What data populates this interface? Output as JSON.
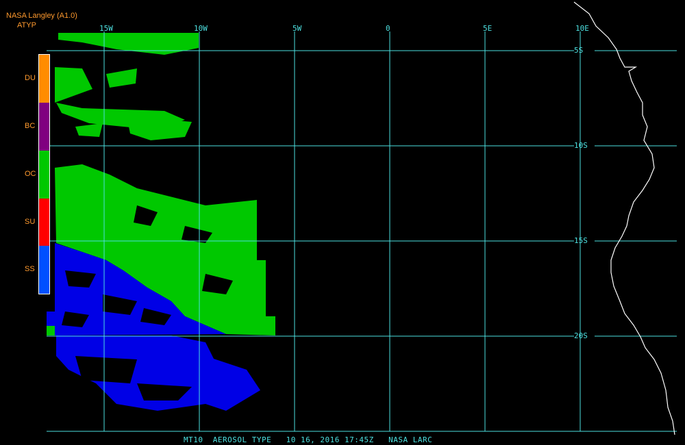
{
  "header": {
    "line1": "NASA Langley (A1.0)",
    "line2": "ATYP"
  },
  "legend": [
    {
      "code": "DU",
      "color": "#ff8c00"
    },
    {
      "code": "BC",
      "color": "#800080"
    },
    {
      "code": "OC",
      "color": "#00c800"
    },
    {
      "code": "SU",
      "color": "#ff0000"
    },
    {
      "code": "SS",
      "color": "#0050ff"
    }
  ],
  "grid": {
    "color": "#4de0e0",
    "longitudes": [
      "15W",
      "10W",
      "5W",
      "0",
      "5E",
      "10E"
    ],
    "latitudes": [
      "5S",
      "10S",
      "15S",
      "20S"
    ]
  },
  "caption": "MT10  AEROSOL TYPE   10 16, 2016 17:45Z   NASA LARC",
  "colors": {
    "background": "#000000",
    "coast": "#ffffff",
    "oc_fill": "#00c800",
    "ss_fill": "#0000e6"
  }
}
